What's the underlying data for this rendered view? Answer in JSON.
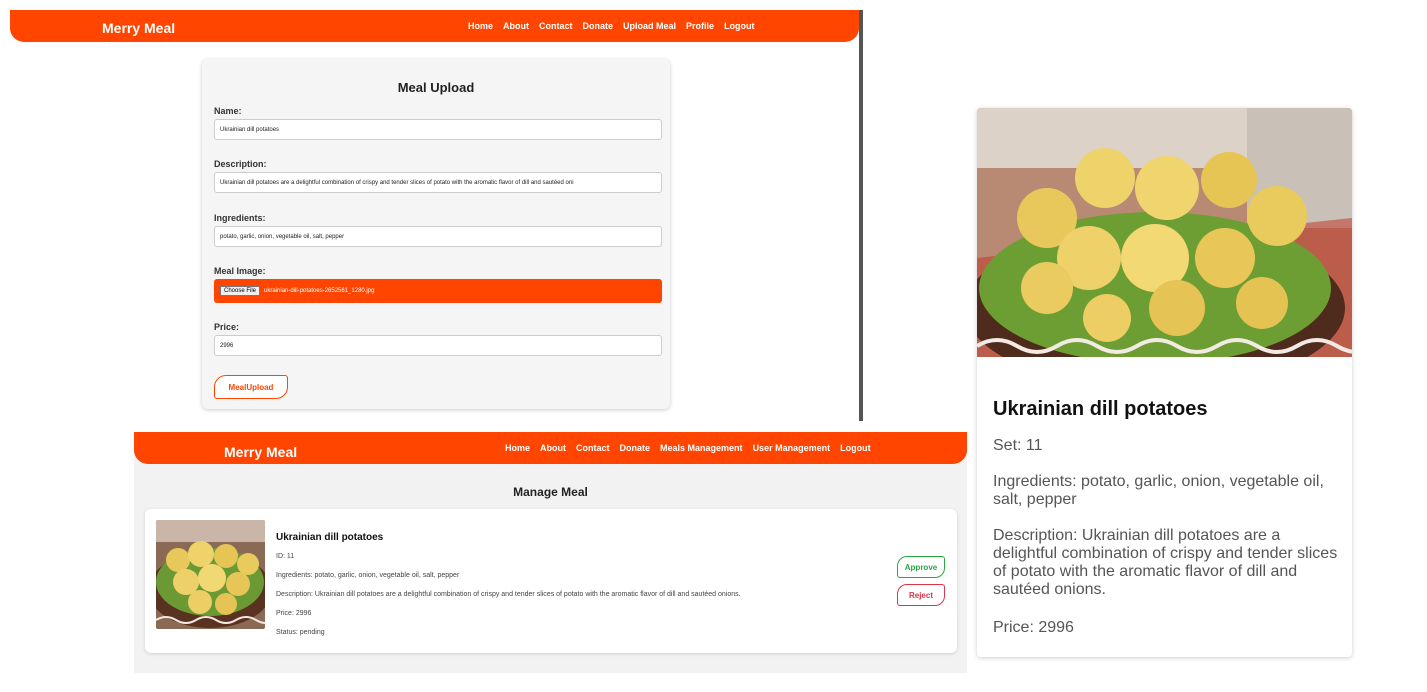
{
  "upload_page": {
    "nav": {
      "brand": "Merry Meal",
      "links": [
        "Home",
        "About",
        "Contact",
        "Donate",
        "Upload Meal",
        "Profile",
        "Logout"
      ]
    },
    "form": {
      "title": "Meal Upload",
      "name_label": "Name:",
      "name_value": "Ukrainian dill potatoes",
      "description_label": "Description:",
      "description_value": "Ukrainian dill potatoes are a delightful combination of crispy and tender slices of potato with the aromatic flavor of dill and sautéed oni",
      "ingredients_label": "Ingredients:",
      "ingredients_value": "potato, garlic, onion, vegetable oil, salt, pepper",
      "image_label": "Meal Image:",
      "file_button": "Choose File",
      "file_name": "ukrainian-dill-potatoes-2652561_1280.jpg",
      "price_label": "Price:",
      "price_value": "2996",
      "submit_label": "MealUpload"
    }
  },
  "manage_page": {
    "nav": {
      "brand": "Merry Meal",
      "links": [
        "Home",
        "About",
        "Contact",
        "Donate",
        "Meals Management",
        "User Management",
        "Logout"
      ]
    },
    "title": "Manage Meal",
    "meal": {
      "name": "Ukrainian dill potatoes",
      "id": "ID: 11",
      "ingredients": "Ingredients: potato, garlic, onion, vegetable oil, salt, pepper",
      "description": "Description: Ukrainian dill potatoes are a delightful combination of crispy and tender slices of potato with the aromatic flavor of dill and sautéed onions.",
      "price": "Price: 2996",
      "status": "Status: pending",
      "approve_label": "Approve",
      "reject_label": "Reject"
    }
  },
  "detail_card": {
    "name": "Ukrainian dill potatoes",
    "set": "Set: 11",
    "ingredients": "Ingredients: potato, garlic, onion, vegetable oil, salt, pepper",
    "description": "Description: Ukrainian dill potatoes are a delightful combination of crispy and tender slices of potato with the aromatic flavor of dill and sautéed onions.",
    "price": "Price: 2996"
  },
  "colors": {
    "accent": "#ff4500",
    "approve": "#28a745",
    "reject": "#dc3545"
  },
  "icons": [
    "meal-photo-potatoes"
  ]
}
